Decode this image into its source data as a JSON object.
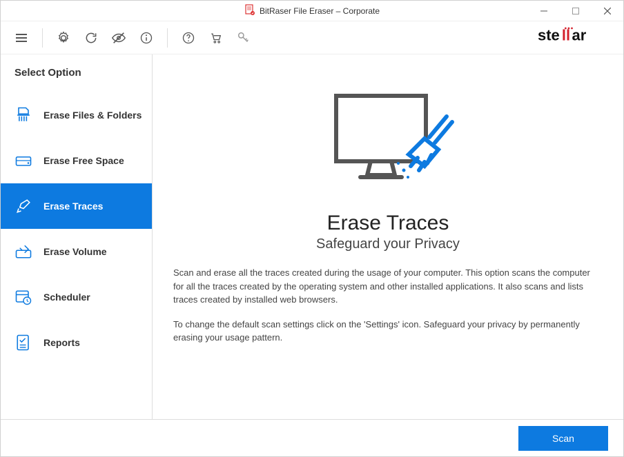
{
  "window": {
    "title": "BitRaser File Eraser – Corporate"
  },
  "sidebar": {
    "title": "Select Option",
    "items": [
      {
        "label": "Erase Files & Folders"
      },
      {
        "label": "Erase Free Space"
      },
      {
        "label": "Erase Traces"
      },
      {
        "label": "Erase Volume"
      },
      {
        "label": "Scheduler"
      },
      {
        "label": "Reports"
      }
    ]
  },
  "content": {
    "heading": "Erase Traces",
    "subheading": "Safeguard your Privacy",
    "para1": "Scan and erase all the traces created during the usage of your computer. This option scans the computer for all the traces created by the operating system and other installed applications. It also scans and lists traces created by installed web browsers.",
    "para2": "To change the default scan settings click on the 'Settings' icon. Safeguard your privacy by permanently erasing your usage pattern."
  },
  "footer": {
    "scan_label": "Scan"
  },
  "logo_text": "stellar"
}
